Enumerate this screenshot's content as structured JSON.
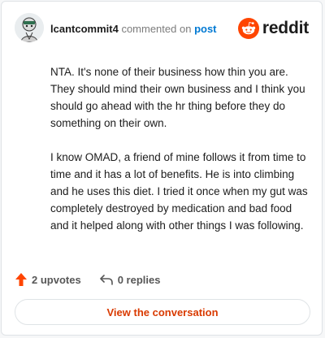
{
  "header": {
    "username": "lcantcommit4",
    "action_text": "commented on",
    "post_link": "post",
    "brand_name": "reddit"
  },
  "comment": {
    "paragraphs": [
      "NTA. It's none of their business how thin you are. They should mind their own business and I think you should go ahead with the hr thing before they do something on their own.",
      "I know OMAD, a friend of mine follows it from time to time and it has a lot of benefits. He is into climbing and he uses this diet. I tried it once when my gut was completely destroyed by medication and bad food and it helped along with other things I was following."
    ]
  },
  "footer": {
    "upvotes": "2 upvotes",
    "replies": "0 replies",
    "cta_label": "View the conversation"
  },
  "icons": {
    "avatar": "avatar-image",
    "brand": "reddit-snoo-icon",
    "upvote": "upvote-arrow-icon",
    "reply": "reply-arrow-icon"
  },
  "colors": {
    "brand_orange": "#ff4500",
    "link_blue": "#0079d3",
    "cta_text": "#d93a00"
  }
}
